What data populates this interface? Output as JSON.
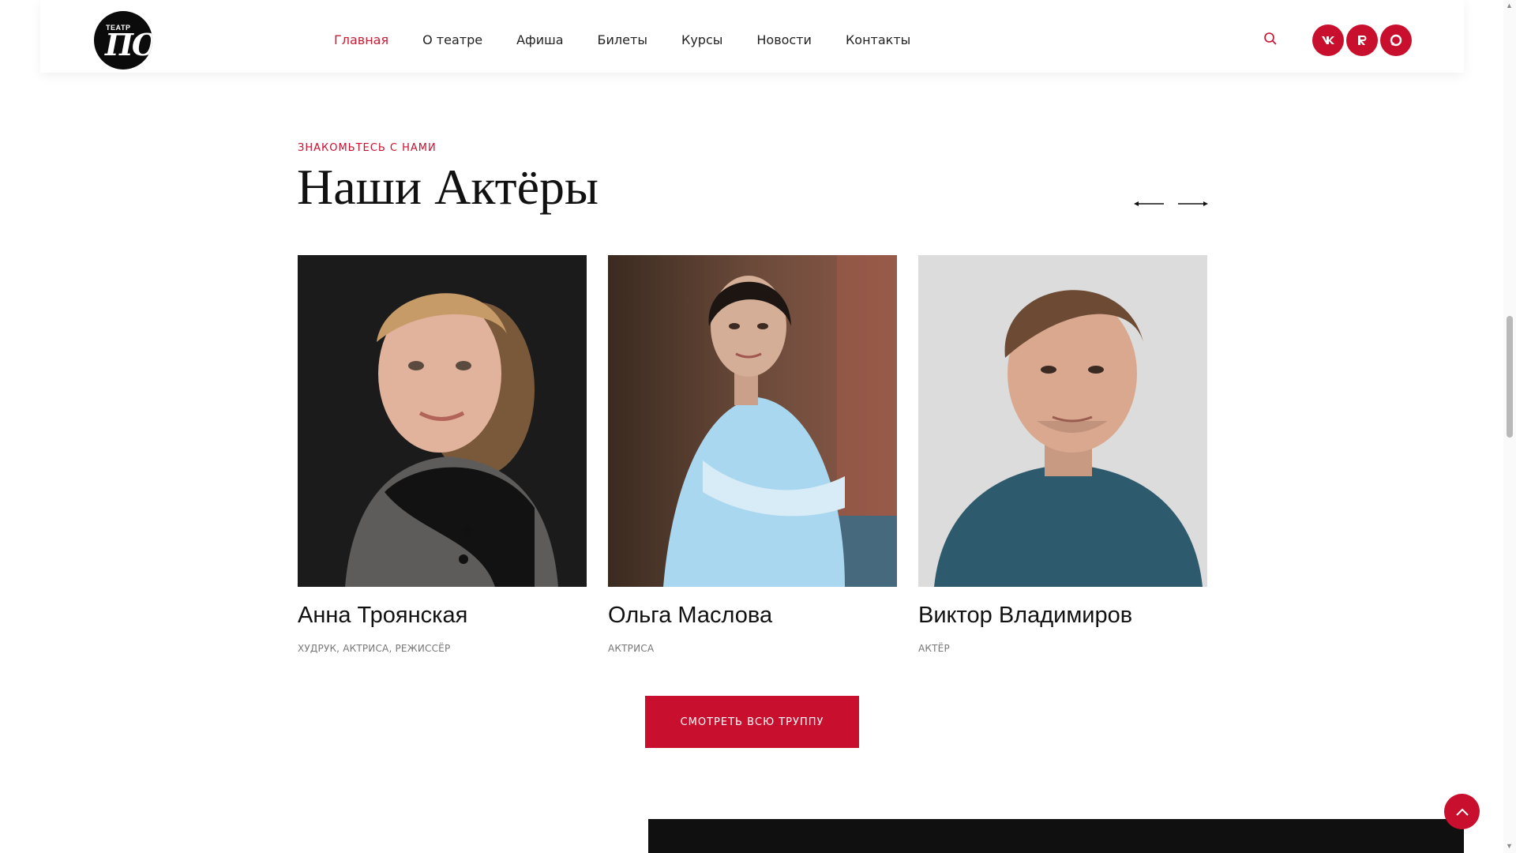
{
  "header": {
    "logo": {
      "small_text": "ТЕАТР",
      "big_text": "ПО"
    },
    "nav": [
      {
        "label": "Главная",
        "active": true
      },
      {
        "label": "О театре",
        "active": false
      },
      {
        "label": "Афиша",
        "active": false
      },
      {
        "label": "Билеты",
        "active": false
      },
      {
        "label": "Курсы",
        "active": false
      },
      {
        "label": "Новости",
        "active": false
      },
      {
        "label": "Контакты",
        "active": false
      }
    ],
    "search_icon": "search-icon",
    "socials": [
      {
        "icon": "vk-icon",
        "glyph": "vk"
      },
      {
        "icon": "rutube-icon",
        "glyph": "R"
      },
      {
        "icon": "chat-icon",
        "glyph": "◉"
      }
    ]
  },
  "section": {
    "eyebrow": "ЗНАКОМЬТЕСЬ С НАМИ",
    "title": "Наши Актёры",
    "actors": [
      {
        "name": "Анна Троянская",
        "role": "ХУДРУК, АКТРИСА, РЕЖИССЁР"
      },
      {
        "name": "Ольга Маслова",
        "role": "АКТРИСА"
      },
      {
        "name": "Виктор Владимиров",
        "role": "АКТЁР"
      }
    ],
    "cta_label": "СМОТРЕТЬ ВСЮ ТРУППУ"
  },
  "colors": {
    "accent": "#c8102e",
    "text": "#111111",
    "muted": "#777777"
  }
}
